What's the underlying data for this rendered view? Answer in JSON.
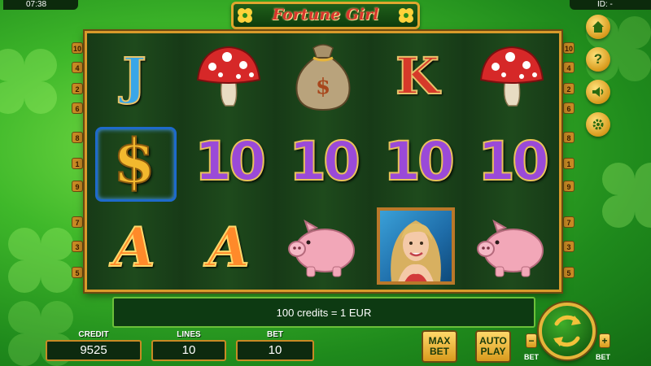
{
  "status": {
    "clock": "07:38",
    "id_label": "ID: -"
  },
  "game": {
    "title": "Fortune Girl"
  },
  "line_numbers": {
    "left": [
      "10",
      "4",
      "2",
      "6",
      "8",
      "1",
      "9",
      "7",
      "3",
      "5"
    ],
    "right": [
      "10",
      "4",
      "2",
      "6",
      "8",
      "1",
      "9",
      "7",
      "3",
      "5"
    ]
  },
  "reels": [
    [
      "J",
      "$",
      "A"
    ],
    [
      "mushroom",
      "10",
      "A"
    ],
    [
      "money-bag",
      "10",
      "piggy-bank"
    ],
    [
      "K",
      "10",
      "fortune-girl"
    ],
    [
      "mushroom",
      "10",
      "piggy-bank"
    ]
  ],
  "side_buttons": [
    "home-icon",
    "help-icon",
    "sound-icon",
    "settings-icon"
  ],
  "info": {
    "message": "100 credits = 1 EUR"
  },
  "stats": {
    "credit": {
      "label": "CREDIT",
      "value": "9525"
    },
    "lines": {
      "label": "LINES",
      "value": "10"
    },
    "bet": {
      "label": "BET",
      "value": "10"
    }
  },
  "controls": {
    "max_bet": {
      "line1": "MAX",
      "line2": "BET"
    },
    "auto_play": {
      "line1": "AUTO",
      "line2": "PLAY"
    },
    "bet_minus": {
      "symbol": "−",
      "label": "BET"
    },
    "bet_plus": {
      "symbol": "+",
      "label": "BET"
    }
  },
  "colors": {
    "accent": "#d99a2b",
    "background": "#3fb82a",
    "reel_bg": "#173a17"
  }
}
